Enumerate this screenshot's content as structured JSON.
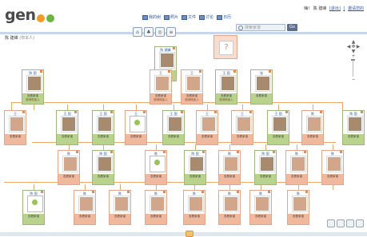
{
  "header": {
    "logo_text": "gen",
    "user_greeting": "嗨！ 陈 建峰",
    "user_link1": "[退出]",
    "user_link2": "[",
    "user_link3": "邀请您的"
  },
  "colors": {
    "male_foot": "#b9d28c",
    "female_foot": "#f0b89c",
    "connector": "#f0a868",
    "link": "#2a5aa8"
  },
  "nav": [
    {
      "label": "我的树"
    },
    {
      "label": "照片"
    },
    {
      "label": "文件"
    },
    {
      "label": "讨论"
    },
    {
      "label": "日历"
    }
  ],
  "search": {
    "placeholder": "搜索家谱",
    "go_label": "Go"
  },
  "person_title": {
    "name": "陈 建峰",
    "tag": "(你本人)"
  },
  "toolbar": [
    {
      "icon": "home-icon",
      "glyph": "⌂"
    },
    {
      "icon": "tree-icon",
      "glyph": "♣"
    },
    {
      "icon": "globe-icon",
      "glyph": "◎"
    },
    {
      "icon": "list-icon",
      "glyph": "≡"
    }
  ],
  "zoom": {
    "up": "▲",
    "left": "◀",
    "center": "✥",
    "right": "▶",
    "down": "▼",
    "plus": "+",
    "minus": "−"
  },
  "top_card": {
    "symbol": "?"
  },
  "cards": [
    {
      "name": "陈 建峰",
      "f1": "查看家谱",
      "f2": "邀请他加入",
      "gender": "male"
    },
    {
      "name": "",
      "f1": "查看家谱",
      "f2": "",
      "gender": "female"
    },
    {
      "name": "",
      "f1": "查看家谱",
      "f2": "",
      "gender": "unknown"
    },
    {
      "name": "陈 国",
      "f1": "查看家谱",
      "f2": "邀请他加入",
      "gender": "male"
    },
    {
      "name": "王 ",
      "f1": "查看家谱",
      "f2": "邀请她加入",
      "gender": "female"
    },
    {
      "name": "王 ",
      "f1": "查看家谱",
      "f2": "邀请她加入",
      "gender": "female"
    },
    {
      "name": "王 国",
      "f1": "查看家谱",
      "f2": "邀请他加入",
      "gender": "male"
    },
    {
      "name": "张 ",
      "f1": "查看家谱",
      "f2": "",
      "gender": "male"
    },
    {
      "name": "王 ",
      "f1": "查看家谱",
      "f2": "",
      "gender": "female"
    },
    {
      "name": "王 国",
      "f1": "查看家谱",
      "f2": "",
      "gender": "male"
    },
    {
      "name": "王 国",
      "f1": "查看家谱",
      "f2": "",
      "gender": "male"
    },
    {
      "name": "王 ",
      "f1": "查看家谱",
      "f2": "",
      "gender": "female"
    },
    {
      "name": "王 国",
      "f1": "查看家谱",
      "f2": "",
      "gender": "male"
    },
    {
      "name": "王 ",
      "f1": "查看家谱",
      "f2": "",
      "gender": "female"
    },
    {
      "name": "王 ",
      "f1": "查看家谱",
      "f2": "",
      "gender": "female"
    },
    {
      "name": "王 国",
      "f1": "查看家谱",
      "f2": "",
      "gender": "male"
    },
    {
      "name": "陈 ",
      "f1": "查看家谱",
      "f2": "",
      "gender": "female"
    },
    {
      "name": "陈 国",
      "f1": "查看家谱",
      "f2": "",
      "gender": "male"
    },
    {
      "name": "陈 ",
      "f1": "查看家谱",
      "f2": "",
      "gender": "female"
    },
    {
      "name": "陈 国",
      "f1": "查看家谱",
      "f2": "",
      "gender": "male"
    },
    {
      "name": "陈 ",
      "f1": "查看家谱",
      "f2": "",
      "gender": "female"
    },
    {
      "name": "陈 国",
      "f1": "查看家谱",
      "f2": "",
      "gender": "male"
    },
    {
      "name": "陈 ",
      "f1": "查看家谱",
      "f2": "",
      "gender": "female"
    },
    {
      "name": "陈 国",
      "f1": "查看家谱",
      "f2": "",
      "gender": "male"
    },
    {
      "name": "陈 ",
      "f1": "查看家谱",
      "f2": "",
      "gender": "female"
    },
    {
      "name": "陈 ",
      "f1": "查看家谱",
      "f2": "",
      "gender": "female"
    },
    {
      "name": "陈 国",
      "f1": "查看家谱",
      "f2": "",
      "gender": "male"
    },
    {
      "name": "陈 ",
      "f1": "查看家谱",
      "f2": "",
      "gender": "female"
    },
    {
      "name": "陈 ",
      "f1": "查看家谱",
      "f2": "",
      "gender": "female"
    },
    {
      "name": "陈 ",
      "f1": "查看家谱",
      "f2": "",
      "gender": "female"
    },
    {
      "name": "陈 ",
      "f1": "查看家谱",
      "f2": "",
      "gender": "female"
    },
    {
      "name": "陈 ",
      "f1": "查看家谱",
      "f2": "",
      "gender": "female"
    },
    {
      "name": "陈 ",
      "f1": "查看家谱",
      "f2": "",
      "gender": "female"
    },
    {
      "name": "陈 ",
      "f1": "查看家谱",
      "f2": "",
      "gender": "female"
    }
  ]
}
